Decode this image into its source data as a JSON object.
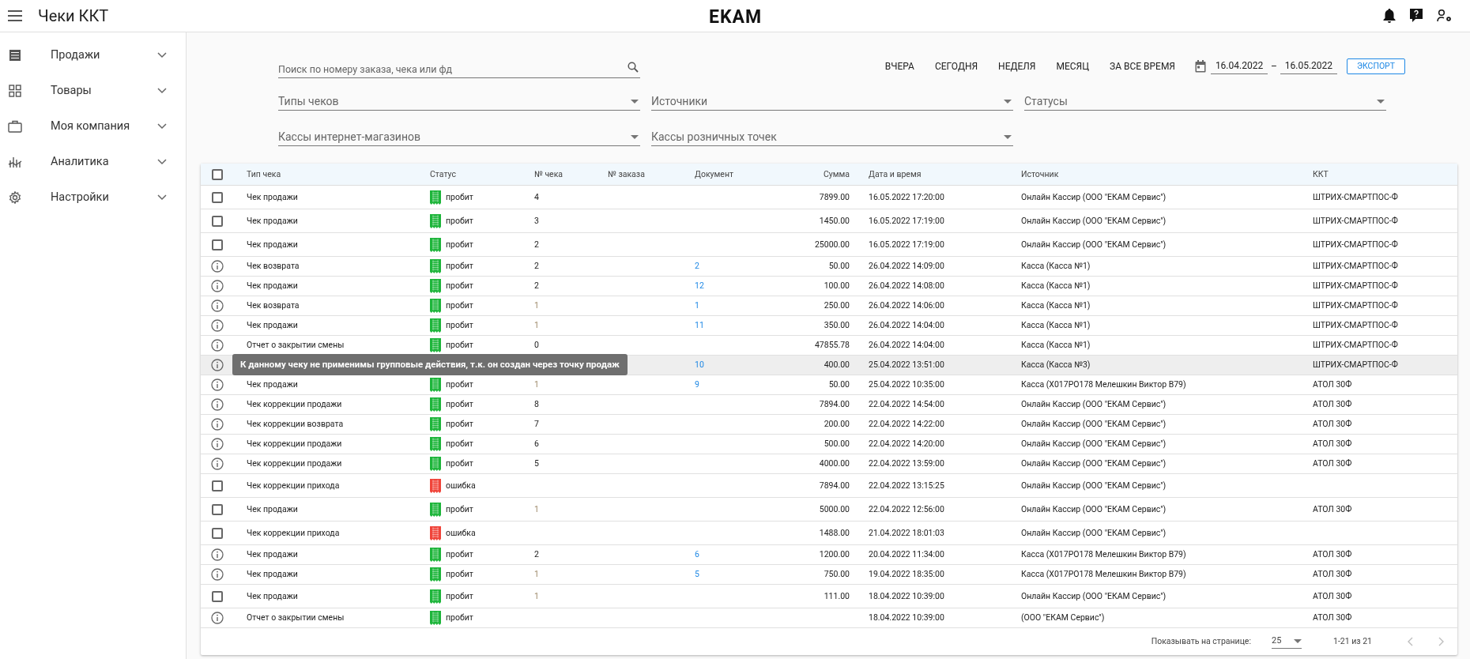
{
  "header": {
    "title": "Чеки ККТ",
    "logo": "EKAM"
  },
  "sidebar": {
    "items": [
      {
        "label": "Продажи",
        "expanded": false
      },
      {
        "label": "Товары",
        "expanded": false
      },
      {
        "label": "Моя компания",
        "expanded": false
      },
      {
        "label": "Аналитика",
        "expanded": false
      },
      {
        "label": "Настройки",
        "expanded": false
      }
    ]
  },
  "filters": {
    "search": {
      "placeholder": "Поиск по номеру заказа, чека или фд"
    },
    "periods": [
      {
        "label": "ВЧЕРА",
        "selected": false
      },
      {
        "label": "СЕГОДНЯ",
        "selected": false
      },
      {
        "label": "НЕДЕЛЯ",
        "selected": false
      },
      {
        "label": "МЕСЯЦ",
        "selected": false
      },
      {
        "label": "ЗА ВСЕ ВРЕМЯ",
        "selected": false
      }
    ],
    "date_from": "16.04.2022",
    "date_sep": "–",
    "date_to": "16.05.2022",
    "export_button": "ЭКСПОРТ",
    "selects": [
      {
        "placeholder": "Типы чеков"
      },
      {
        "placeholder": "Источники"
      },
      {
        "placeholder": "Статусы"
      },
      {
        "placeholder": "Кассы интернет-магазинов"
      },
      {
        "placeholder": "Кассы розничных точек"
      }
    ]
  },
  "table": {
    "all_checked": false,
    "columns": [
      "Тип чека",
      "Статус",
      "№ чека",
      "№ заказа",
      "Документ",
      "Сумма",
      "Дата и время",
      "Источник",
      "ККТ"
    ],
    "rows": [
      {
        "kind": "checkbox",
        "checked": false,
        "type": "Чек продажи",
        "status": "пробит",
        "color": "#1db53a",
        "check_no": "4",
        "check_no_muted": false,
        "sum": "7899.00",
        "datetime": "16.05.2022 17:20:00",
        "source": "Онлайн Кассир (ООО \"ЕКАМ Сервис\")",
        "kkt": "ШТРИХ-СМАРТПОС-Ф"
      },
      {
        "kind": "checkbox",
        "checked": false,
        "type": "Чек продажи",
        "status": "пробит",
        "color": "#1db53a",
        "check_no": "3",
        "check_no_muted": false,
        "sum": "1450.00",
        "datetime": "16.05.2022 17:19:00",
        "source": "Онлайн Кассир (ООО \"ЕКАМ Сервис\")",
        "kkt": "ШТРИХ-СМАРТПОС-Ф"
      },
      {
        "kind": "checkbox",
        "checked": false,
        "type": "Чек продажи",
        "status": "пробит",
        "color": "#1db53a",
        "check_no": "2",
        "check_no_muted": false,
        "sum": "25000.00",
        "datetime": "16.05.2022 17:19:00",
        "source": "Онлайн Кассир (ООО \"ЕКАМ Сервис\")",
        "kkt": "ШТРИХ-СМАРТПОС-Ф"
      },
      {
        "kind": "info",
        "type": "Чек возврата",
        "status": "пробит",
        "color": "#1db53a",
        "check_no": "2",
        "check_no_muted": false,
        "document": "2",
        "sum": "50.00",
        "datetime": "26.04.2022 14:09:00",
        "source": "Касса (Касса №1)",
        "kkt": "ШТРИХ-СМАРТПОС-Ф"
      },
      {
        "kind": "info",
        "type": "Чек продажи",
        "status": "пробит",
        "color": "#1db53a",
        "check_no": "2",
        "check_no_muted": false,
        "document": "12",
        "sum": "100.00",
        "datetime": "26.04.2022 14:08:00",
        "source": "Касса (Касса №1)",
        "kkt": "ШТРИХ-СМАРТПОС-Ф"
      },
      {
        "kind": "info",
        "type": "Чек возврата",
        "status": "пробит",
        "color": "#1db53a",
        "check_no": "1",
        "check_no_muted": true,
        "document": "1",
        "sum": "250.00",
        "datetime": "26.04.2022 14:06:00",
        "source": "Касса (Касса №1)",
        "kkt": "ШТРИХ-СМАРТПОС-Ф"
      },
      {
        "kind": "info",
        "type": "Чек продажи",
        "status": "пробит",
        "color": "#1db53a",
        "check_no": "1",
        "check_no_muted": true,
        "document": "11",
        "sum": "350.00",
        "datetime": "26.04.2022 14:04:00",
        "source": "Касса (Касса №1)",
        "kkt": "ШТРИХ-СМАРТПОС-Ф"
      },
      {
        "kind": "info",
        "type": "Отчет о закрытии смены",
        "status": "пробит",
        "color": "#1db53a",
        "check_no": "0",
        "check_no_muted": false,
        "sum": "47855.78",
        "datetime": "26.04.2022 14:04:00",
        "source": "Касса (Касса №1)",
        "kkt": "ШТРИХ-СМАРТПОС-Ф"
      },
      {
        "kind": "info",
        "hovered": true,
        "tooltip": "К данному чеку не применимы групповые действия, т.к. он создан через точку продаж",
        "document": "10",
        "sum": "400.00",
        "datetime": "25.04.2022 13:51:00",
        "source": "Касса (Касса №3)",
        "kkt": "ШТРИХ-СМАРТПОС-Ф"
      },
      {
        "kind": "info",
        "type": "Чек продажи",
        "status": "пробит",
        "color": "#1db53a",
        "check_no": "1",
        "check_no_muted": true,
        "document": "9",
        "sum": "50.00",
        "datetime": "25.04.2022 10:35:00",
        "source": "Касса (Х017РО178 Мелешкин Виктор В79)",
        "kkt": "АТОЛ 30Ф"
      },
      {
        "kind": "info",
        "type": "Чек коррекции продажи",
        "status": "пробит",
        "color": "#1db53a",
        "check_no": "8",
        "check_no_muted": false,
        "sum": "7894.00",
        "datetime": "22.04.2022 14:54:00",
        "source": "Онлайн Кассир (ООО \"ЕКАМ Сервис\")",
        "kkt": "АТОЛ 30Ф"
      },
      {
        "kind": "info",
        "type": "Чек коррекции возврата",
        "status": "пробит",
        "color": "#1db53a",
        "check_no": "7",
        "check_no_muted": false,
        "sum": "200.00",
        "datetime": "22.04.2022 14:22:00",
        "source": "Онлайн Кассир (ООО \"ЕКАМ Сервис\")",
        "kkt": "АТОЛ 30Ф"
      },
      {
        "kind": "info",
        "type": "Чек коррекции продажи",
        "status": "пробит",
        "color": "#1db53a",
        "check_no": "6",
        "check_no_muted": false,
        "sum": "500.00",
        "datetime": "22.04.2022 14:20:00",
        "source": "Онлайн Кассир (ООО \"ЕКАМ Сервис\")",
        "kkt": "АТОЛ 30Ф"
      },
      {
        "kind": "info",
        "type": "Чек коррекции продажи",
        "status": "пробит",
        "color": "#1db53a",
        "check_no": "5",
        "check_no_muted": false,
        "sum": "4000.00",
        "datetime": "22.04.2022 13:59:00",
        "source": "Онлайн Кассир (ООО \"ЕКАМ Сервис\")",
        "kkt": "АТОЛ 30Ф"
      },
      {
        "kind": "checkbox",
        "checked": false,
        "type": "Чек коррекции прихода",
        "status": "ошибка",
        "color": "#f0443a",
        "sum": "7894.00",
        "datetime": "22.04.2022 13:15:25",
        "source": "Онлайн Кассир (ООО \"ЕКАМ Сервис\")"
      },
      {
        "kind": "checkbox",
        "checked": false,
        "type": "Чек продажи",
        "status": "пробит",
        "color": "#1db53a",
        "check_no": "1",
        "check_no_muted": true,
        "sum": "5000.00",
        "datetime": "22.04.2022 12:56:00",
        "source": "Онлайн Кассир (ООО \"ЕКАМ Сервис\")",
        "kkt": "АТОЛ 30Ф"
      },
      {
        "kind": "checkbox",
        "checked": false,
        "type": "Чек коррекции прихода",
        "status": "ошибка",
        "color": "#f0443a",
        "sum": "1488.00",
        "datetime": "21.04.2022 18:01:03",
        "source": "Онлайн Кассир (ООО \"ЕКАМ Сервис\")"
      },
      {
        "kind": "info",
        "type": "Чек продажи",
        "status": "пробит",
        "color": "#1db53a",
        "check_no": "2",
        "check_no_muted": false,
        "document": "6",
        "sum": "1200.00",
        "datetime": "20.04.2022 11:34:00",
        "source": "Касса (Х017РО178 Мелешкин Виктор В79)",
        "kkt": "АТОЛ 30Ф"
      },
      {
        "kind": "info",
        "type": "Чек продажи",
        "status": "пробит",
        "color": "#1db53a",
        "check_no": "1",
        "check_no_muted": true,
        "document": "5",
        "sum": "750.00",
        "datetime": "19.04.2022 18:35:00",
        "source": "Касса (Х017РО178 Мелешкин Виктор В79)",
        "kkt": "АТОЛ 30Ф"
      },
      {
        "kind": "checkbox",
        "checked": false,
        "type": "Чек продажи",
        "status": "пробит",
        "color": "#1db53a",
        "check_no": "1",
        "check_no_muted": true,
        "sum": "111.00",
        "datetime": "18.04.2022 10:39:00",
        "source": "Онлайн Кассир (ООО \"ЕКАМ Сервис\")",
        "kkt": "АТОЛ 30Ф"
      },
      {
        "kind": "info",
        "type": "Отчет о закрытии смены",
        "status": "пробит",
        "color": "#1db53a",
        "datetime": "18.04.2022 10:39:00",
        "source": "(ООО \"ЕКАМ Сервис\")",
        "kkt": "АТОЛ 30Ф"
      }
    ]
  },
  "pagination": {
    "label": "Показывать на странице:",
    "page_size": "25",
    "range": "1-21 из 21",
    "prev_disabled": true,
    "next_disabled": true
  }
}
